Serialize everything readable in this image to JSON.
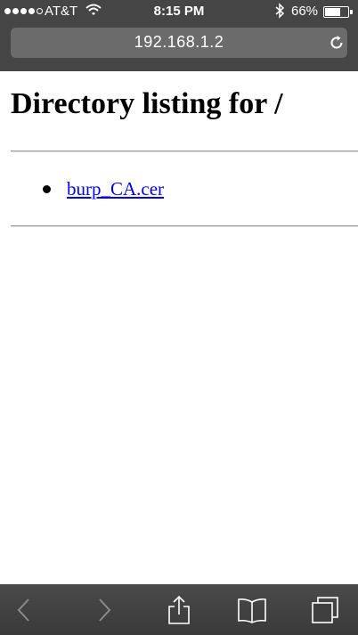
{
  "status_bar": {
    "carrier": "AT&T",
    "time": "8:15 PM",
    "battery_percent": "66%",
    "battery_level": 0.66,
    "signal_bars_filled": 4,
    "signal_bars_total": 5
  },
  "browser": {
    "url": "192.168.1.2"
  },
  "page": {
    "title": "Directory listing for /",
    "files": [
      {
        "name": "burp_CA.cer"
      }
    ]
  },
  "toolbar": {
    "icons": [
      "chevron-left-icon",
      "chevron-right-icon",
      "share-icon",
      "bookmarks-icon",
      "tabs-icon"
    ]
  },
  "colors": {
    "chrome_bg": "#454545",
    "url_bar_bg": "#6b6b6b",
    "link": "#0000ee"
  }
}
